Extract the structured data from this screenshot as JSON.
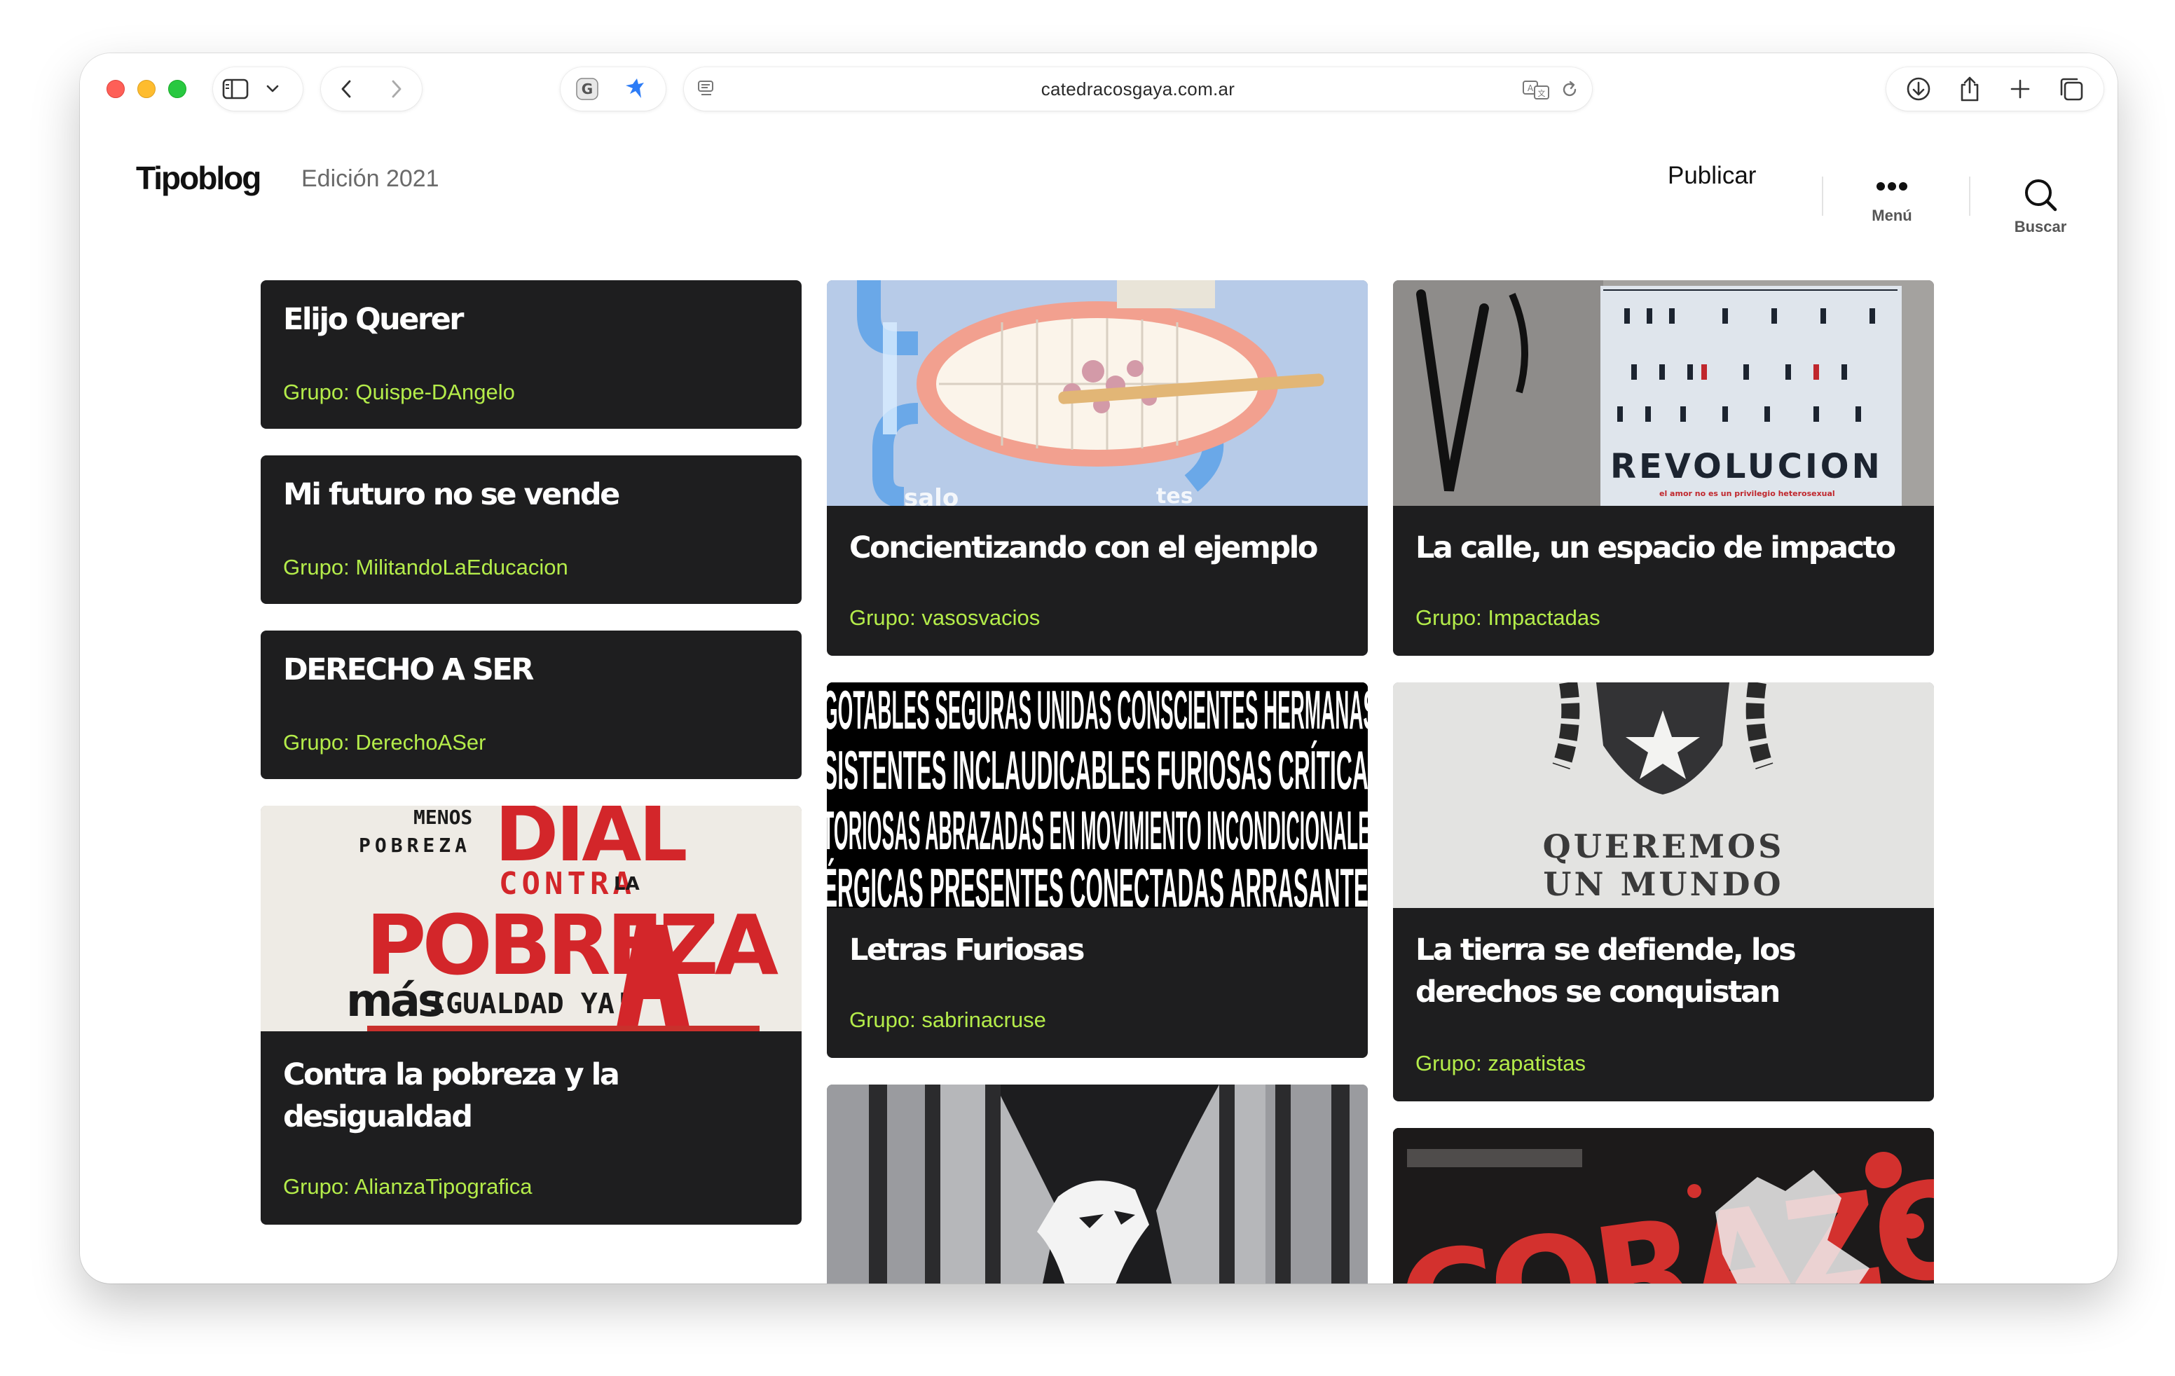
{
  "browser": {
    "url": "catedracosgaya.com.ar"
  },
  "site": {
    "logo": "Tipoblog",
    "edition": "Edición 2021",
    "publish_label": "Publicar",
    "menu_label": "Menú",
    "search_label": "Buscar"
  },
  "posts": [
    {
      "title": "Elijo Querer",
      "group": "Grupo: Quispe-DAngelo"
    },
    {
      "title": "Mi futuro no se vende",
      "group": "Grupo: MilitandoLaEducacion"
    },
    {
      "title": "DERECHO A SER",
      "group": "Grupo: DerechoASer"
    },
    {
      "title": "Contra la pobreza y la desigualdad",
      "group": "Grupo: AlianzaTipografica",
      "image_text": {
        "l1": "MENOS",
        "l2": "POBREZA",
        "l3": "DIAL",
        "l4": "CONTRA",
        "l5": "LA",
        "l6": "POBREZA",
        "l7": "más",
        "l8": "IGUALDAD YA!"
      }
    },
    {
      "title": "Concientizando con el ejemplo",
      "group": "Grupo: vasosvacios"
    },
    {
      "title": "Letras Furiosas",
      "group": "Grupo: sabrinacruse",
      "image_text": [
        "GOTABLES SEGURAS UNIDAS CONSCIENTES HERMANAS",
        "SISTENTES INCLAUDICABLES FURIOSAS CRÍTICAS",
        "TORIOSAS ABRAZADAS EN MOVIMIENTO INCONDICIONALES",
        "ÉRGICAS PRESENTES CONECTADAS ARRASANTES"
      ]
    },
    {
      "title": "La calle, un espacio de impacto",
      "group": "Grupo: Impactadas",
      "image_text": {
        "word": "REVOLUCION",
        "caption": "el amor no es un privilegio heterosexual"
      }
    },
    {
      "title": "La tierra se defiende, los derechos se conquistan",
      "group": "Grupo: zapatistas",
      "image_text": {
        "l1": "QUEREMOS",
        "l2": "UN MUNDO"
      }
    },
    {
      "image_text": "CORAZONES"
    }
  ],
  "colors": {
    "card_bg": "#1e1e1f",
    "group_text": "#b4ec4a",
    "title_text": "#ffffff"
  }
}
